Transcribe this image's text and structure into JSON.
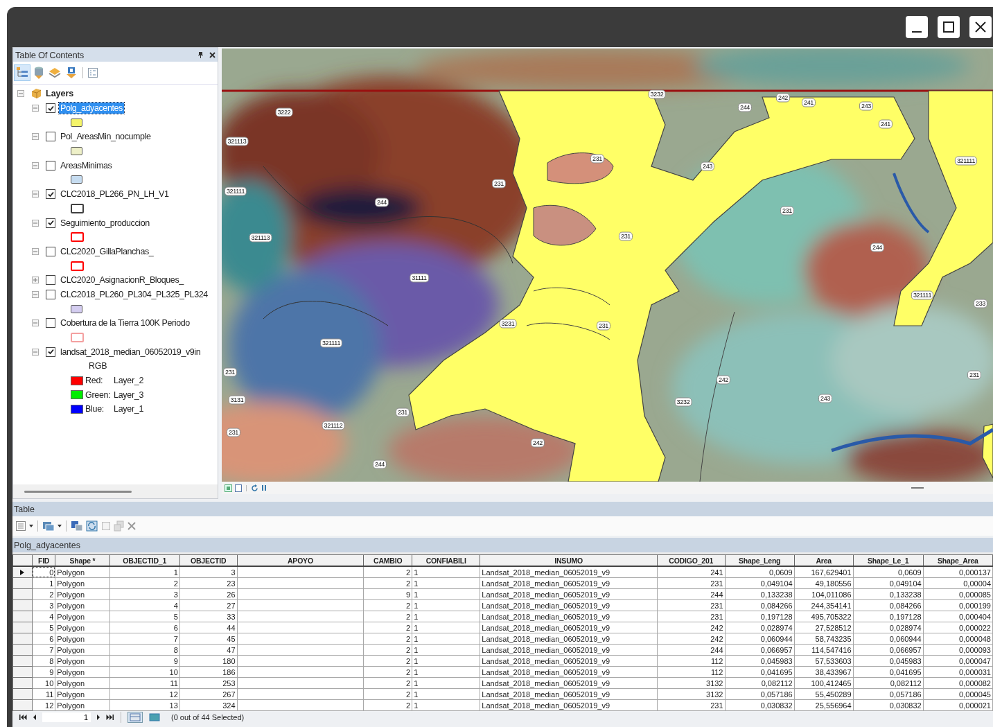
{
  "toc": {
    "title": "Table Of Contents",
    "root": {
      "label": "Layers",
      "expanded": true
    },
    "layers": [
      {
        "name": "Polg_adyacentes",
        "checked": true,
        "selected": true,
        "expanded": true,
        "kind": "fill",
        "color": "#f5f56a"
      },
      {
        "name": "Pol_AreasMin_nocumple",
        "checked": false,
        "selected": false,
        "expanded": true,
        "kind": "fill",
        "color": "#eef0c8"
      },
      {
        "name": "AreasMinimas",
        "checked": false,
        "selected": false,
        "expanded": true,
        "kind": "fill",
        "color": "#c6dcf0"
      },
      {
        "name": "CLC2018_PL266_PN_LH_V1",
        "checked": true,
        "selected": false,
        "expanded": true,
        "kind": "outline",
        "color": "#404040"
      },
      {
        "name": "Seguimiento_produccion",
        "checked": true,
        "selected": false,
        "expanded": true,
        "kind": "outline",
        "color": "#ff0000"
      },
      {
        "name": "CLC2020_GillaPlanchas_",
        "checked": false,
        "selected": false,
        "expanded": true,
        "kind": "outline",
        "color": "#ff0000"
      },
      {
        "name": "CLC2020_AsignacionR_Bloques_",
        "checked": false,
        "selected": false,
        "expanded": false
      },
      {
        "name": "CLC2018_PL260_PL304_PL325_PL324",
        "checked": false,
        "selected": false,
        "expanded": true,
        "kind": "fill",
        "color": "#d4cdf0"
      },
      {
        "name": "Cobertura de la Tierra 100K Periodo",
        "checked": false,
        "selected": false,
        "expanded": true,
        "kind": "outline",
        "color": "#f4a0a0"
      },
      {
        "name": "landsat_2018_median_06052019_v9in",
        "checked": true,
        "selected": false,
        "expanded": true,
        "kind": "raster",
        "legend_title": "RGB",
        "bands": [
          {
            "label": "Red:",
            "value": "Layer_2",
            "color": "#ff0000"
          },
          {
            "label": "Green:",
            "value": "Layer_3",
            "color": "#00ee00"
          },
          {
            "label": "Blue:",
            "value": "Layer_1",
            "color": "#0000ff"
          }
        ]
      }
    ]
  },
  "map": {
    "labels": [
      "3222",
      "3232",
      "244",
      "242",
      "241",
      "243",
      "241",
      "321113",
      "231",
      "243",
      "321111",
      "321111",
      "231",
      "244",
      "231",
      "321113",
      "231",
      "244",
      "31111",
      "321111",
      "233",
      "3231",
      "231",
      "321111",
      "231",
      "242",
      "231",
      "3131",
      "3232",
      "243",
      "231",
      "321112",
      "231",
      "242",
      "244"
    ]
  },
  "table": {
    "title": "Table",
    "layer_tab": "Polg_adyacentes",
    "columns": [
      "FID",
      "Shape *",
      "OBJECTID_1",
      "OBJECTID",
      "APOYO",
      "CAMBIO",
      "CONFIABILI",
      "INSUMO",
      "CODIGO_201",
      "Shape_Leng",
      "Area",
      "Shape_Le_1",
      "Shape_Area"
    ],
    "rows": [
      {
        "current": true,
        "cells": [
          "0",
          "Polygon",
          "1",
          "3",
          null,
          "2",
          "1",
          "Landsat_2018_median_06052019_v9",
          "241",
          "0,0609",
          "167,629401",
          "0,0609",
          "0,000137"
        ]
      },
      {
        "current": false,
        "cells": [
          "1",
          "Polygon",
          "2",
          "23",
          null,
          "2",
          "1",
          "Landsat_2018_median_06052019_v9",
          "231",
          "0,049104",
          "49,180556",
          "0,049104",
          "0,00004"
        ]
      },
      {
        "current": false,
        "cells": [
          "2",
          "Polygon",
          "3",
          "26",
          null,
          "9",
          "1",
          "Landsat_2018_median_06052019_v9",
          "244",
          "0,133238",
          "104,011086",
          "0,133238",
          "0,000085"
        ]
      },
      {
        "current": false,
        "cells": [
          "3",
          "Polygon",
          "4",
          "27",
          null,
          "2",
          "1",
          "Landsat_2018_median_06052019_v9",
          "231",
          "0,084266",
          "244,354141",
          "0,084266",
          "0,000199"
        ]
      },
      {
        "current": false,
        "cells": [
          "4",
          "Polygon",
          "5",
          "33",
          null,
          "2",
          "1",
          "Landsat_2018_median_06052019_v9",
          "231",
          "0,197128",
          "495,705322",
          "0,197128",
          "0,000404"
        ]
      },
      {
        "current": false,
        "cells": [
          "5",
          "Polygon",
          "6",
          "44",
          null,
          "2",
          "1",
          "Landsat_2018_median_06052019_v9",
          "242",
          "0,028974",
          "27,528512",
          "0,028974",
          "0,000022"
        ]
      },
      {
        "current": false,
        "cells": [
          "6",
          "Polygon",
          "7",
          "45",
          null,
          "2",
          "1",
          "Landsat_2018_median_06052019_v9",
          "242",
          "0,060944",
          "58,743235",
          "0,060944",
          "0,000048"
        ]
      },
      {
        "current": false,
        "cells": [
          "7",
          "Polygon",
          "8",
          "47",
          null,
          "2",
          "1",
          "Landsat_2018_median_06052019_v9",
          "244",
          "0,066957",
          "114,547416",
          "0,066957",
          "0,000093"
        ]
      },
      {
        "current": false,
        "cells": [
          "8",
          "Polygon",
          "9",
          "180",
          null,
          "2",
          "1",
          "Landsat_2018_median_06052019_v9",
          "112",
          "0,045983",
          "57,533603",
          "0,045983",
          "0,000047"
        ]
      },
      {
        "current": false,
        "cells": [
          "9",
          "Polygon",
          "10",
          "186",
          null,
          "2",
          "1",
          "Landsat_2018_median_06052019_v9",
          "112",
          "0,041695",
          "38,433967",
          "0,041695",
          "0,000031"
        ]
      },
      {
        "current": false,
        "cells": [
          "10",
          "Polygon",
          "11",
          "253",
          null,
          "2",
          "1",
          "Landsat_2018_median_06052019_v9",
          "3132",
          "0,082112",
          "100,412465",
          "0,082112",
          "0,000082"
        ]
      },
      {
        "current": false,
        "cells": [
          "11",
          "Polygon",
          "12",
          "267",
          null,
          "2",
          "1",
          "Landsat_2018_median_06052019_v9",
          "3132",
          "0,057186",
          "55,450289",
          "0,057186",
          "0,000045"
        ]
      },
      {
        "current": false,
        "cells": [
          "12",
          "Polygon",
          "13",
          "324",
          null,
          "2",
          "1",
          "Landsat_2018_median_06052019_v9",
          "231",
          "0,030832",
          "25,556964",
          "0,030832",
          "0,000021"
        ]
      }
    ],
    "record": "1",
    "selection_status": "(0 out of 44 Selected)"
  }
}
